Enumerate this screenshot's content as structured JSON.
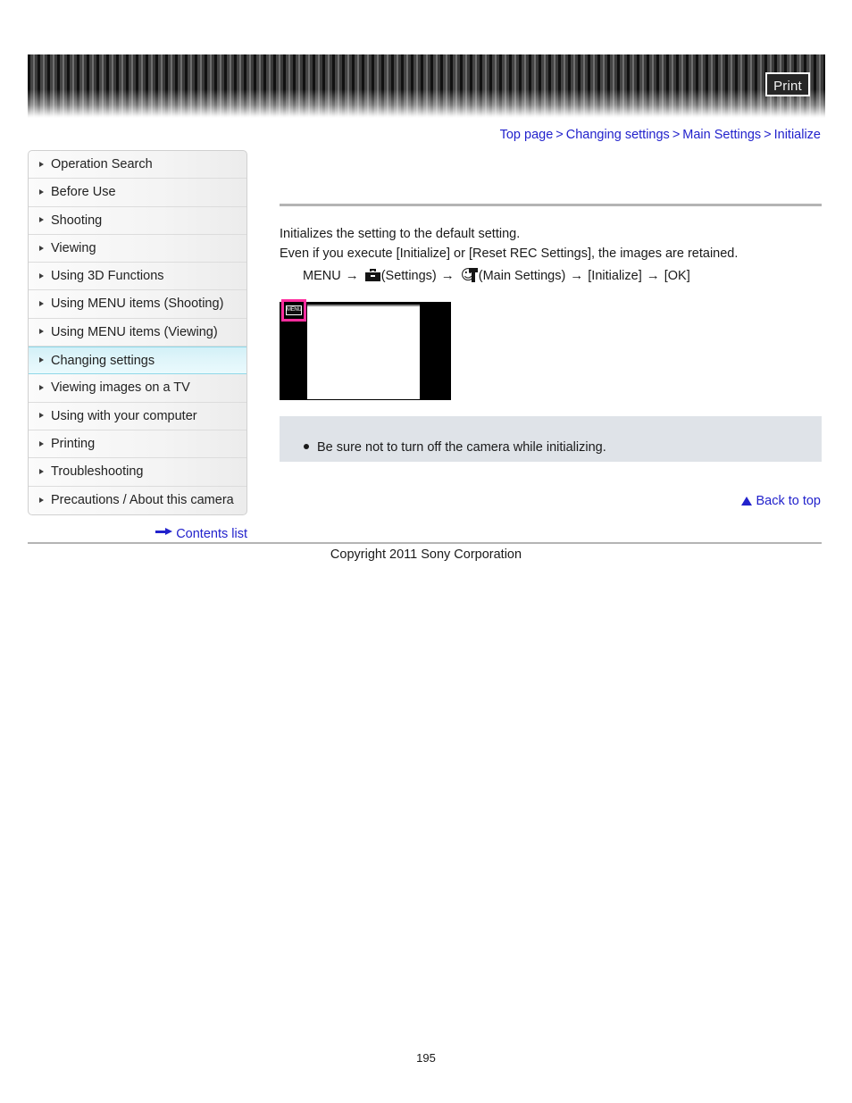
{
  "header": {
    "print_label": "Print"
  },
  "breadcrumb": {
    "items": [
      {
        "label": "Top page"
      },
      {
        "label": "Changing settings"
      },
      {
        "label": "Main Settings"
      },
      {
        "label": "Initialize"
      }
    ],
    "separator": ">"
  },
  "sidebar": {
    "items": [
      {
        "label": "Operation Search",
        "active": false
      },
      {
        "label": "Before Use",
        "active": false
      },
      {
        "label": "Shooting",
        "active": false
      },
      {
        "label": "Viewing",
        "active": false
      },
      {
        "label": "Using 3D Functions",
        "active": false
      },
      {
        "label": "Using MENU items (Shooting)",
        "active": false
      },
      {
        "label": "Using MENU items (Viewing)",
        "active": false
      },
      {
        "label": "Changing settings",
        "active": true
      },
      {
        "label": "Viewing images on a TV",
        "active": false
      },
      {
        "label": "Using with your computer",
        "active": false
      },
      {
        "label": "Printing",
        "active": false
      },
      {
        "label": "Troubleshooting",
        "active": false
      },
      {
        "label": "Precautions / About this camera",
        "active": false
      }
    ],
    "contents_list_label": "Contents list"
  },
  "main": {
    "paragraph_1": "Initializes the setting to the default setting.",
    "paragraph_2": "Even if you execute [Initialize] or [Reset REC Settings], the images are retained.",
    "menu_path": {
      "start": "MENU",
      "arrow": "→",
      "settings_label": "(Settings)",
      "main_settings_label": "(Main Settings)",
      "initialize_label": "[Initialize]",
      "ok_label": "[OK]"
    },
    "screen_illustration": {
      "menu_button_text": "MENU"
    },
    "note": {
      "text": "Be sure not to turn off the camera while initializing."
    },
    "back_to_top_label": "Back to top"
  },
  "footer": {
    "copyright": "Copyright 2011 Sony Corporation",
    "page_number": "195"
  },
  "colors": {
    "link": "#2222CC",
    "active_nav": "#DFF5FA",
    "note_bg": "#DFE3E8",
    "highlight_pink": "#FF2D9E"
  }
}
